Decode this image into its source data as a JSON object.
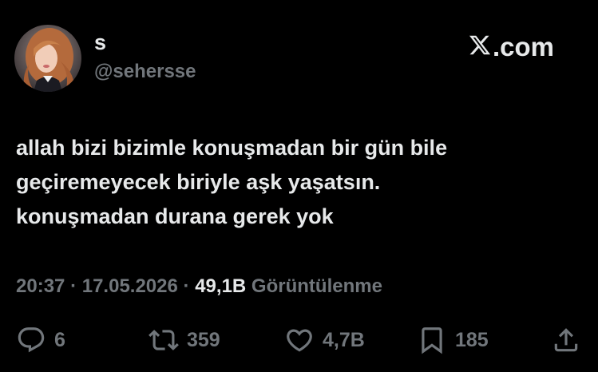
{
  "header": {
    "display_name": "s",
    "handle": "@sehersse",
    "brand_domain": ".com",
    "brand_icon": "x-logo-icon"
  },
  "tweet": {
    "lines": [
      "allah bizi bizimle konuşmadan bir gün bile",
      "geçiremeyecek biriyle aşk yaşatsın.",
      "konuşmadan durana gerek yok"
    ]
  },
  "meta": {
    "time": "20:37",
    "separator": "·",
    "date": "17.05.2026",
    "views_count": "49,1B",
    "views_label": "Görüntülenme"
  },
  "actions": {
    "reply": {
      "icon": "reply-icon",
      "count": "6"
    },
    "retweet": {
      "icon": "retweet-icon",
      "count": "359"
    },
    "like": {
      "icon": "heart-icon",
      "count": "4,7B"
    },
    "bookmark": {
      "icon": "bookmark-icon",
      "count": "185"
    },
    "share": {
      "icon": "share-icon"
    }
  },
  "colors": {
    "background": "#000000",
    "primary_text": "#e7e9ea",
    "secondary_text": "#71767b"
  }
}
